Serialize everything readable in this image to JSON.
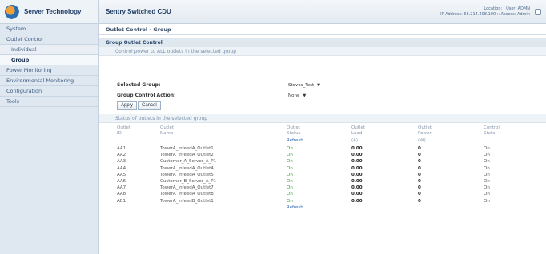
{
  "brand": {
    "name": "Server Technology"
  },
  "sidebar": {
    "items": [
      {
        "label": "System"
      },
      {
        "label": "Outlet Control"
      },
      {
        "label": "Individual"
      },
      {
        "label": "Group"
      },
      {
        "label": "Power Monitoring"
      },
      {
        "label": "Environmental Monitoring"
      },
      {
        "label": "Configuration"
      },
      {
        "label": "Tools"
      }
    ]
  },
  "header": {
    "title": "Sentry Switched CDU",
    "location_line": "Location:  :  User: ADMN",
    "address_line": "IP Address: 66.214.208.100 :: Access: Admin"
  },
  "page": {
    "title": "Outlet Control - Group",
    "section_title": "Group Outlet Control",
    "section_subtitle": "Control power to ALL outlets in the selected group",
    "selected_group_label": "Selected Group:",
    "selected_group_value": "Steves_Test",
    "action_label": "Group Control Action:",
    "action_value": "None",
    "apply_label": "Apply",
    "cancel_label": "Cancel",
    "status_title": "Status of outlets in the selected group"
  },
  "table": {
    "headers": {
      "id": [
        "Outlet",
        "ID"
      ],
      "name": [
        "Outlet",
        "Name"
      ],
      "status": [
        "Outlet",
        "Status"
      ],
      "load": [
        "Outlet",
        "Load"
      ],
      "power": [
        "Outlet",
        "Power"
      ],
      "state": [
        "Control",
        "State"
      ]
    },
    "units": {
      "load": "(A)",
      "power": "(W)"
    },
    "refresh_label": "Refresh",
    "rows": [
      {
        "id": "AA1",
        "name": "TowerA_InfeedA_Outlet1",
        "status": "On",
        "load": "0.00",
        "power": "0",
        "state": "On"
      },
      {
        "id": "AA2",
        "name": "TowerA_InfeedA_Outlet2",
        "status": "On",
        "load": "0.00",
        "power": "0",
        "state": "On"
      },
      {
        "id": "AA3",
        "name": "Customer_A_Server_A_P1",
        "status": "On",
        "load": "0.00",
        "power": "0",
        "state": "On"
      },
      {
        "id": "AA4",
        "name": "TowerA_InfeedA_Outlet4",
        "status": "On",
        "load": "0.00",
        "power": "0",
        "state": "On"
      },
      {
        "id": "AA5",
        "name": "TowerA_InfeedA_Outlet5",
        "status": "On",
        "load": "0.00",
        "power": "0",
        "state": "On"
      },
      {
        "id": "AA6",
        "name": "Customer_B_Server_A_P1",
        "status": "On",
        "load": "0.00",
        "power": "0",
        "state": "On"
      },
      {
        "id": "AA7",
        "name": "TowerA_InfeedA_Outlet7",
        "status": "On",
        "load": "0.00",
        "power": "0",
        "state": "On"
      },
      {
        "id": "AA8",
        "name": "TowerA_InfeedA_Outlet8",
        "status": "On",
        "load": "0.00",
        "power": "0",
        "state": "On"
      },
      {
        "id": "AB1",
        "name": "TowerA_InfeedB_Outlet1",
        "status": "On",
        "load": "0.00",
        "power": "0",
        "state": "On"
      }
    ]
  }
}
